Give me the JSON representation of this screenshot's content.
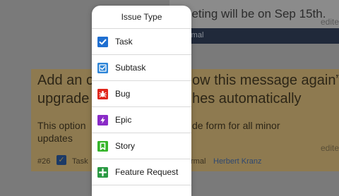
{
  "background": {
    "top_card": {
      "text": "eeting will be on Sep 15th.",
      "edited": "edite",
      "priority": "rmal"
    },
    "main_card": {
      "title_line1_left": "Add an o",
      "title_line1_right": "ow this message again” o",
      "title_line2_left": "upgrade",
      "title_line2_right": "hes automatically",
      "body_line1_left": "This option",
      "body_line1_right": "de form for all minor",
      "body_line2": "updates",
      "edited": "edite",
      "issue_number": "#26",
      "type": "Task",
      "priority": "rmal",
      "author": "Herbert Kranz"
    }
  },
  "popover": {
    "title": "Issue Type",
    "items": [
      {
        "label": "Task",
        "icon": "task-checkbox-icon",
        "color": "#1f6fd1"
      },
      {
        "label": "Subtask",
        "icon": "subtask-icon",
        "color": "#2f86d8"
      },
      {
        "label": "Bug",
        "icon": "bug-icon",
        "color": "#e0261b"
      },
      {
        "label": "Epic",
        "icon": "epic-lightning-icon",
        "color": "#8a2bc7"
      },
      {
        "label": "Story",
        "icon": "story-bookmark-icon",
        "color": "#36b52a"
      },
      {
        "label": "Feature Request",
        "icon": "feature-plus-icon",
        "color": "#2a9a43"
      }
    ]
  }
}
